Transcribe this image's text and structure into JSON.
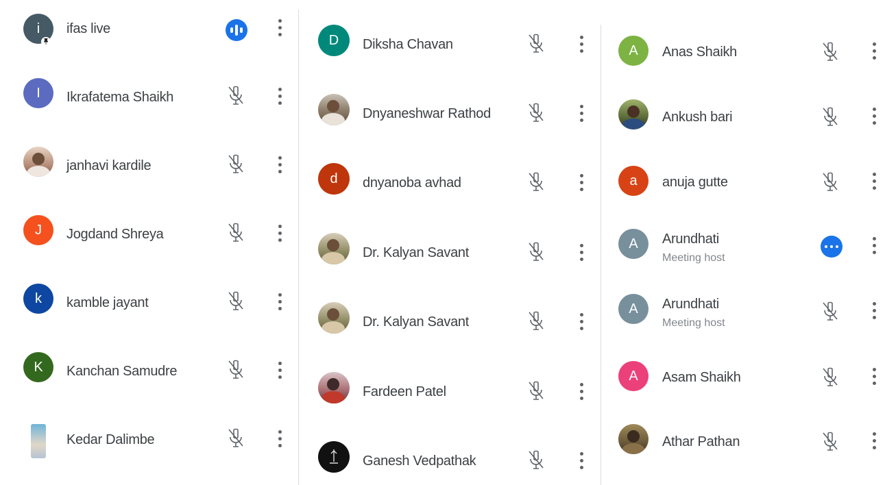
{
  "columns": [
    {
      "participants": [
        {
          "name": "ifas live",
          "initial": "i",
          "avatar_color": "#455a64",
          "pinned": true,
          "status": "speaking"
        },
        {
          "name": "Ikrafatema Shaikh",
          "initial": "I",
          "avatar_color": "#5c6bc0",
          "status": "muted"
        },
        {
          "name": "janhavi kardile",
          "initial": "",
          "avatar_color": "",
          "photo": true,
          "status": "muted"
        },
        {
          "name": "Jogdand Shreya",
          "initial": "J",
          "avatar_color": "#f4511e",
          "status": "muted"
        },
        {
          "name": "kamble jayant",
          "initial": "k",
          "avatar_color": "#0d47a1",
          "status": "muted"
        },
        {
          "name": "Kanchan Samudre",
          "initial": "K",
          "avatar_color": "#33691e",
          "status": "muted"
        },
        {
          "name": "Kedar Dalimbe",
          "initial": "",
          "avatar_color": "",
          "photo": true,
          "status": "muted"
        }
      ]
    },
    {
      "participants": [
        {
          "name": "Diksha Chavan",
          "initial": "D",
          "avatar_color": "#00897b",
          "status": "muted"
        },
        {
          "name": "Dnyaneshwar Rathod",
          "initial": "",
          "avatar_color": "",
          "photo": true,
          "status": "muted"
        },
        {
          "name": "dnyanoba avhad",
          "initial": "d",
          "avatar_color": "#bf360c",
          "status": "muted"
        },
        {
          "name": "Dr. Kalyan Savant",
          "initial": "",
          "avatar_color": "",
          "photo": true,
          "status": "muted"
        },
        {
          "name": "Dr. Kalyan Savant",
          "initial": "",
          "avatar_color": "",
          "photo": true,
          "status": "muted"
        },
        {
          "name": "Fardeen Patel",
          "initial": "",
          "avatar_color": "",
          "photo": true,
          "status": "muted"
        },
        {
          "name": "Ganesh Vedpathak",
          "initial": "",
          "avatar_color": "#111111",
          "photo": true,
          "status": "muted"
        }
      ]
    },
    {
      "participants": [
        {
          "name": "Anas Shaikh",
          "initial": "A",
          "avatar_color": "#7cb342",
          "status": "muted"
        },
        {
          "name": "Ankush bari",
          "initial": "",
          "avatar_color": "",
          "photo": true,
          "status": "muted"
        },
        {
          "name": "anuja gutte",
          "initial": "a",
          "avatar_color": "#d84315",
          "status": "muted"
        },
        {
          "name": "Arundhati",
          "subtitle": "Meeting host",
          "initial": "A",
          "avatar_color": "#78909c",
          "status": "active"
        },
        {
          "name": "Arundhati",
          "subtitle": "Meeting host",
          "initial": "A",
          "avatar_color": "#78909c",
          "status": "muted"
        },
        {
          "name": "Asam Shaikh",
          "initial": "A",
          "avatar_color": "#ec407a",
          "status": "muted"
        },
        {
          "name": "Athar Pathan",
          "initial": "",
          "avatar_color": "",
          "photo": true,
          "status": "muted"
        }
      ]
    }
  ]
}
